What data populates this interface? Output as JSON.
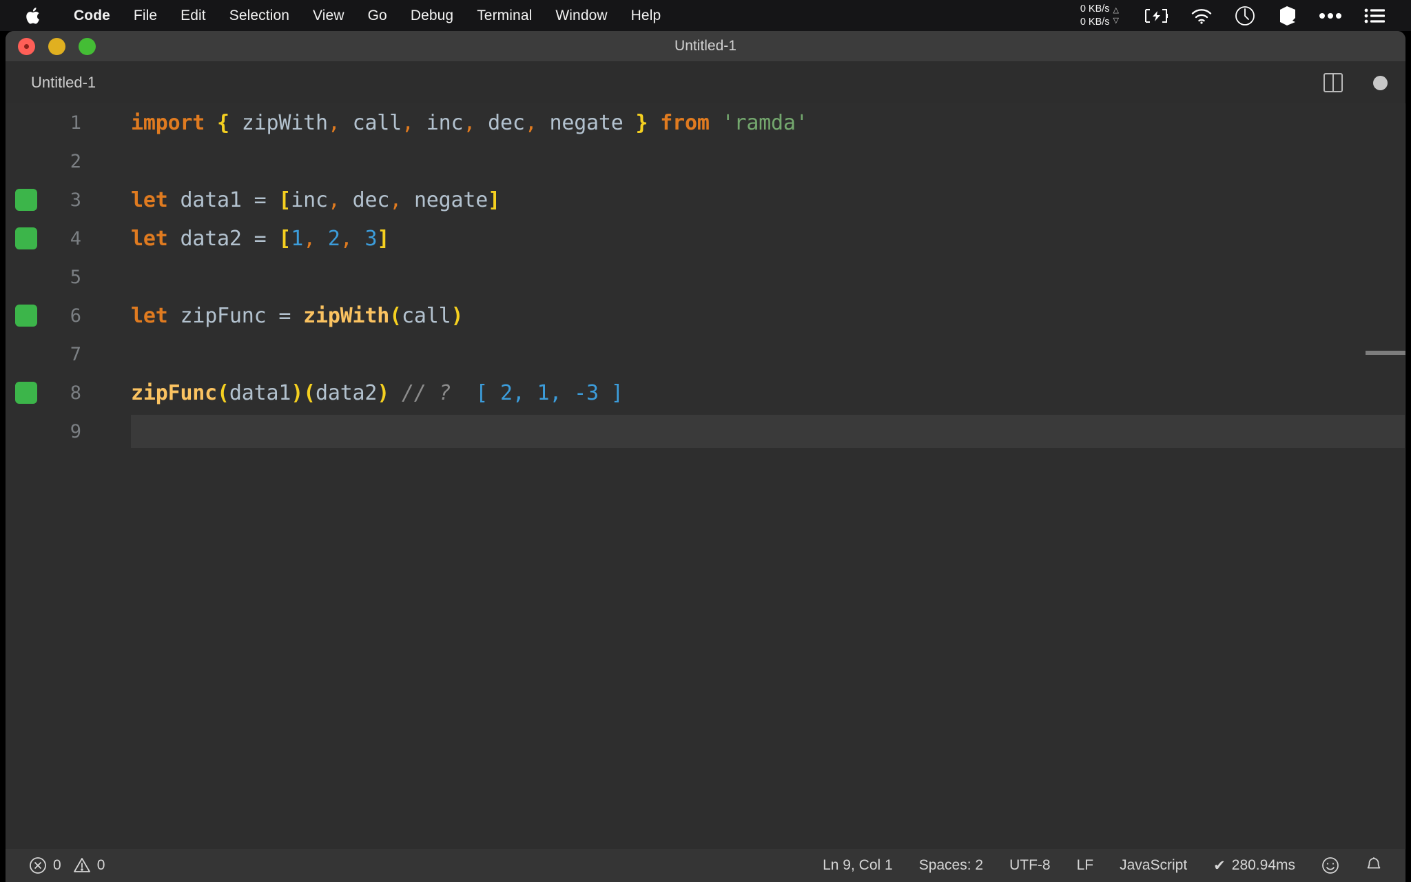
{
  "menubar": {
    "apple_icon": "apple-logo-icon",
    "items": [
      {
        "label": "Code",
        "bold": true
      },
      {
        "label": "File",
        "bold": false
      },
      {
        "label": "Edit",
        "bold": false
      },
      {
        "label": "Selection",
        "bold": false
      },
      {
        "label": "View",
        "bold": false
      },
      {
        "label": "Go",
        "bold": false
      },
      {
        "label": "Debug",
        "bold": false
      },
      {
        "label": "Terminal",
        "bold": false
      },
      {
        "label": "Window",
        "bold": false
      },
      {
        "label": "Help",
        "bold": false
      }
    ],
    "tray": {
      "net_up": "0 KB/s",
      "net_down": "0 KB/s",
      "up_arrow": "△",
      "down_arrow": "▽",
      "icons": [
        "battery-charging-icon",
        "wifi-icon",
        "clock-icon",
        "cube-icon",
        "ellipsis-icon",
        "list-icon"
      ]
    }
  },
  "window": {
    "title": "Untitled-1",
    "traffic_lights": [
      "close-button",
      "minimize-button",
      "maximize-button"
    ]
  },
  "tab": {
    "label": "Untitled-1",
    "split_editor_icon": "split-editor-icon",
    "unsaved_indicator": "unsaved-dot-icon"
  },
  "editor": {
    "lines": [
      {
        "number": "1",
        "breakpoint": false,
        "current": false,
        "tokens": [
          {
            "t": "import",
            "c": "t-kw"
          },
          {
            "t": " ",
            "c": "t-op"
          },
          {
            "t": "{",
            "c": "t-brace"
          },
          {
            "t": " ",
            "c": "t-op"
          },
          {
            "t": "zipWith",
            "c": "t-var"
          },
          {
            "t": ",",
            "c": "t-punc"
          },
          {
            "t": " ",
            "c": "t-op"
          },
          {
            "t": "call",
            "c": "t-var"
          },
          {
            "t": ",",
            "c": "t-punc"
          },
          {
            "t": " ",
            "c": "t-op"
          },
          {
            "t": "inc",
            "c": "t-var"
          },
          {
            "t": ",",
            "c": "t-punc"
          },
          {
            "t": " ",
            "c": "t-op"
          },
          {
            "t": "dec",
            "c": "t-var"
          },
          {
            "t": ",",
            "c": "t-punc"
          },
          {
            "t": " ",
            "c": "t-op"
          },
          {
            "t": "negate",
            "c": "t-var"
          },
          {
            "t": " ",
            "c": "t-op"
          },
          {
            "t": "}",
            "c": "t-brace"
          },
          {
            "t": " ",
            "c": "t-op"
          },
          {
            "t": "from",
            "c": "t-kw"
          },
          {
            "t": " ",
            "c": "t-op"
          },
          {
            "t": "'ramda'",
            "c": "t-str"
          }
        ]
      },
      {
        "number": "2",
        "breakpoint": false,
        "current": false,
        "tokens": []
      },
      {
        "number": "3",
        "breakpoint": true,
        "current": false,
        "tokens": [
          {
            "t": "let",
            "c": "t-kw"
          },
          {
            "t": " ",
            "c": "t-op"
          },
          {
            "t": "data1",
            "c": "t-var"
          },
          {
            "t": " = ",
            "c": "t-op"
          },
          {
            "t": "[",
            "c": "t-brace"
          },
          {
            "t": "inc",
            "c": "t-var"
          },
          {
            "t": ",",
            "c": "t-punc"
          },
          {
            "t": " ",
            "c": "t-op"
          },
          {
            "t": "dec",
            "c": "t-var"
          },
          {
            "t": ",",
            "c": "t-punc"
          },
          {
            "t": " ",
            "c": "t-op"
          },
          {
            "t": "negate",
            "c": "t-var"
          },
          {
            "t": "]",
            "c": "t-brace"
          }
        ]
      },
      {
        "number": "4",
        "breakpoint": true,
        "current": false,
        "tokens": [
          {
            "t": "let",
            "c": "t-kw"
          },
          {
            "t": " ",
            "c": "t-op"
          },
          {
            "t": "data2",
            "c": "t-var"
          },
          {
            "t": " = ",
            "c": "t-op"
          },
          {
            "t": "[",
            "c": "t-brace"
          },
          {
            "t": "1",
            "c": "t-num"
          },
          {
            "t": ",",
            "c": "t-punc"
          },
          {
            "t": " ",
            "c": "t-op"
          },
          {
            "t": "2",
            "c": "t-num"
          },
          {
            "t": ",",
            "c": "t-punc"
          },
          {
            "t": " ",
            "c": "t-op"
          },
          {
            "t": "3",
            "c": "t-num"
          },
          {
            "t": "]",
            "c": "t-brace"
          }
        ]
      },
      {
        "number": "5",
        "breakpoint": false,
        "current": false,
        "tokens": []
      },
      {
        "number": "6",
        "breakpoint": true,
        "current": false,
        "tokens": [
          {
            "t": "let",
            "c": "t-kw"
          },
          {
            "t": " ",
            "c": "t-op"
          },
          {
            "t": "zipFunc",
            "c": "t-var"
          },
          {
            "t": " = ",
            "c": "t-op"
          },
          {
            "t": "zipWith",
            "c": "t-fn"
          },
          {
            "t": "(",
            "c": "t-paren"
          },
          {
            "t": "call",
            "c": "t-var"
          },
          {
            "t": ")",
            "c": "t-paren"
          }
        ]
      },
      {
        "number": "7",
        "breakpoint": false,
        "current": false,
        "tokens": []
      },
      {
        "number": "8",
        "breakpoint": true,
        "current": false,
        "tokens": [
          {
            "t": "zipFunc",
            "c": "t-fn"
          },
          {
            "t": "(",
            "c": "t-paren"
          },
          {
            "t": "data1",
            "c": "t-var"
          },
          {
            "t": ")",
            "c": "t-paren"
          },
          {
            "t": "(",
            "c": "t-paren"
          },
          {
            "t": "data2",
            "c": "t-var"
          },
          {
            "t": ")",
            "c": "t-paren"
          },
          {
            "t": " ",
            "c": "t-op"
          },
          {
            "t": "// ?",
            "c": "t-comment"
          },
          {
            "t": "  ",
            "c": "t-op"
          },
          {
            "t": "[ 2, 1, -3 ]",
            "c": "t-result"
          }
        ]
      },
      {
        "number": "9",
        "breakpoint": false,
        "current": true,
        "tokens": []
      }
    ]
  },
  "statusbar": {
    "error_icon": "error-circle-icon",
    "error_count": "0",
    "warning_icon": "warning-triangle-icon",
    "warning_count": "0",
    "cursor_position": "Ln 9, Col 1",
    "indentation": "Spaces: 2",
    "encoding": "UTF-8",
    "eol": "LF",
    "language": "JavaScript",
    "run_check": "✔",
    "run_time": "280.94ms",
    "feedback_icon": "smiley-icon",
    "notifications_icon": "bell-icon"
  }
}
